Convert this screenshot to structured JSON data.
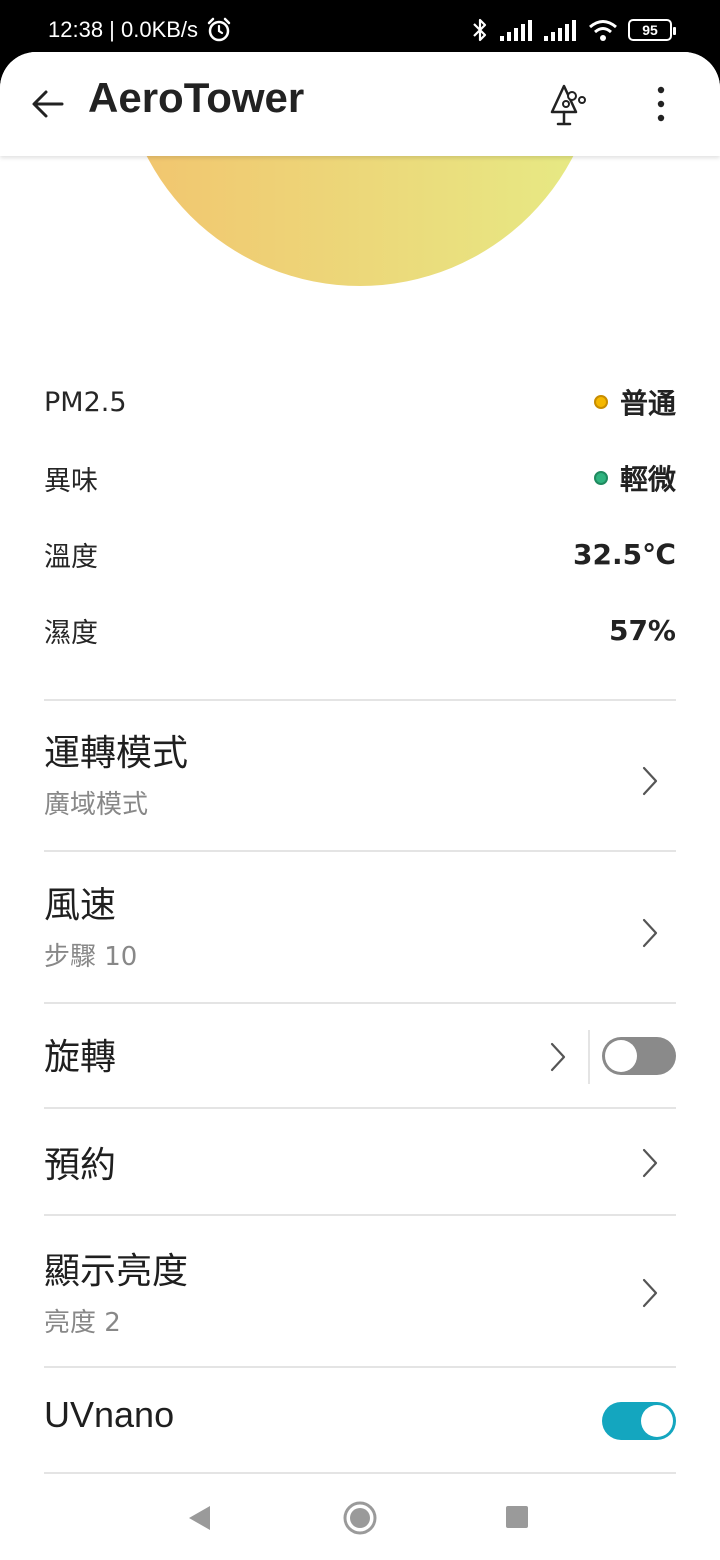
{
  "status_bar": {
    "time_speed": "12:38 | 0.0KB/s",
    "battery": "95"
  },
  "app_bar": {
    "title": "AeroTower"
  },
  "readings": [
    {
      "label": "PM2.5",
      "value": "普通",
      "dot_color": "#f5b800"
    },
    {
      "label": "異味",
      "value": "輕微",
      "dot_color": "#2fb37f"
    },
    {
      "label": "溫度",
      "value": "32.5℃"
    },
    {
      "label": "濕度",
      "value": "57%"
    }
  ],
  "settings": {
    "mode": {
      "title": "運轉模式",
      "sub": "廣域模式"
    },
    "fan_speed": {
      "title": "風速",
      "sub": "步驟 10"
    },
    "oscillation": {
      "title": "旋轉",
      "toggle_on": false
    },
    "schedule": {
      "title": "預約"
    },
    "display_brightness": {
      "title": "顯示亮度",
      "sub": "亮度 2"
    },
    "uvnano": {
      "title": "UVnano",
      "toggle_on": true
    }
  },
  "colors": {
    "accent": "#14a6bf",
    "sun_start": "#f2c46e",
    "sun_end": "#e6eb85"
  }
}
